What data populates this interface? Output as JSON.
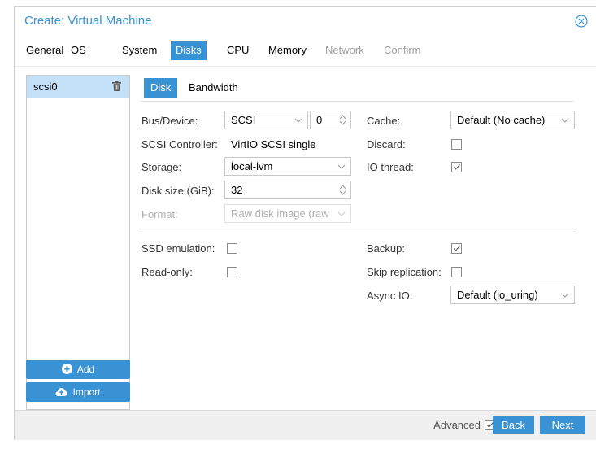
{
  "window": {
    "title": "Create: Virtual Machine"
  },
  "tabs": [
    {
      "label": "General",
      "state": "normal"
    },
    {
      "label": "OS",
      "state": "normal"
    },
    {
      "label": "System",
      "state": "normal"
    },
    {
      "label": "Disks",
      "state": "active"
    },
    {
      "label": "CPU",
      "state": "normal"
    },
    {
      "label": "Memory",
      "state": "normal"
    },
    {
      "label": "Network",
      "state": "disabled"
    },
    {
      "label": "Confirm",
      "state": "disabled"
    }
  ],
  "disks": {
    "items": [
      {
        "label": "scsi0",
        "selected": true
      }
    ]
  },
  "left_buttons": {
    "add_label": "Add",
    "import_label": "Import"
  },
  "subtabs": [
    {
      "label": "Disk",
      "state": "active"
    },
    {
      "label": "Bandwidth",
      "state": "normal"
    }
  ],
  "form": {
    "bus_device": {
      "label": "Bus/Device:",
      "bus": "SCSI",
      "device": "0"
    },
    "scsi_controller": {
      "label": "SCSI Controller:",
      "value": "VirtIO SCSI single"
    },
    "storage": {
      "label": "Storage:",
      "value": "local-lvm"
    },
    "disk_size": {
      "label": "Disk size (GiB):",
      "value": "32"
    },
    "format": {
      "label": "Format:",
      "value": "Raw disk image (raw",
      "disabled": true
    },
    "cache": {
      "label": "Cache:",
      "value": "Default (No cache)"
    },
    "discard": {
      "label": "Discard:",
      "checked": false
    },
    "io_thread": {
      "label": "IO thread:",
      "checked": true
    },
    "ssd_emulation": {
      "label": "SSD emulation:",
      "checked": false
    },
    "read_only": {
      "label": "Read-only:",
      "checked": false
    },
    "backup": {
      "label": "Backup:",
      "checked": true
    },
    "skip_replication": {
      "label": "Skip replication:",
      "checked": false
    },
    "async_io": {
      "label": "Async IO:",
      "value": "Default (io_uring)"
    }
  },
  "footer": {
    "advanced_label": "Advanced",
    "advanced_checked": true,
    "back_label": "Back",
    "next_label": "Next"
  },
  "colors": {
    "accent": "#3892d4",
    "selected_row": "#c5e1f7",
    "footer_bg": "#f0f0f0"
  }
}
